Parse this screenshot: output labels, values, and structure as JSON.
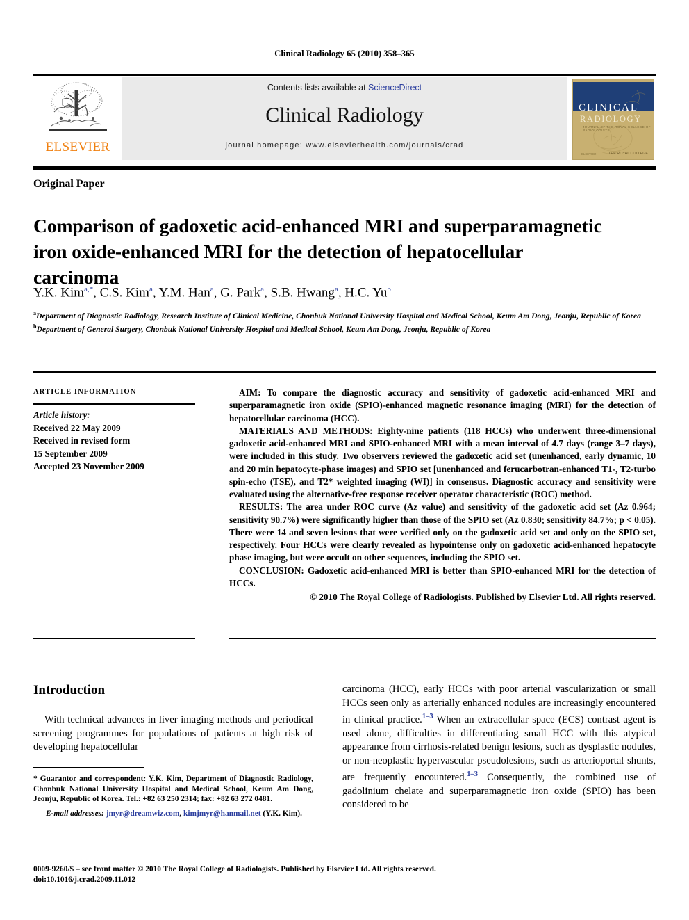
{
  "running_head": "Clinical Radiology 65 (2010) 358–365",
  "banner": {
    "contents_prefix": "Contents lists available at ",
    "sciencedirect": "ScienceDirect",
    "journal_name": "Clinical Radiology",
    "homepage": "journal homepage: www.elsevierhealth.com/journals/crad",
    "publisher_logo_word": "ELSEVIER",
    "cover": {
      "title_line1": "CLINICAL",
      "title_line2": "RADIOLOGY",
      "subtitle": "JOURNAL OF THE ROYAL COLLEGE OF RADIOLOGISTS",
      "footer_left": "ELSEVIER",
      "footer_right": "THE ROYAL COLLEGE"
    }
  },
  "article": {
    "type": "Original Paper",
    "title": "Comparison of gadoxetic acid-enhanced MRI and superparamagnetic iron oxide-enhanced MRI for the detection of hepatocellular carcinoma",
    "authors": [
      {
        "name": "Y.K. Kim",
        "sup": "a,*"
      },
      {
        "name": "C.S. Kim",
        "sup": "a"
      },
      {
        "name": "Y.M. Han",
        "sup": "a"
      },
      {
        "name": "G. Park",
        "sup": "a"
      },
      {
        "name": "S.B. Hwang",
        "sup": "a"
      },
      {
        "name": "H.C. Yu",
        "sup": "b"
      }
    ],
    "affiliations": [
      {
        "marker": "a",
        "text": "Department of Diagnostic Radiology, Research Institute of Clinical Medicine, Chonbuk National University Hospital and Medical School, Keum Am Dong, Jeonju, Republic of Korea"
      },
      {
        "marker": "b",
        "text": "Department of General Surgery, Chonbuk National University Hospital and Medical School, Keum Am Dong, Jeonju, Republic of Korea"
      }
    ]
  },
  "article_information": {
    "heading": "ARTICLE INFORMATION",
    "history_label": "Article history:",
    "history": [
      "Received 22 May 2009",
      "Received in revised form",
      "15 September 2009",
      "Accepted 23 November 2009"
    ]
  },
  "abstract": {
    "aim": "AIM: To compare the diagnostic accuracy and sensitivity of gadoxetic acid-enhanced MRI and superparamagnetic iron oxide (SPIO)-enhanced magnetic resonance imaging (MRI) for the detection of hepatocellular carcinoma (HCC).",
    "materials": "MATERIALS AND METHODS: Eighty-nine patients (118 HCCs) who underwent three-dimensional gadoxetic acid-enhanced MRI and SPIO-enhanced MRI with a mean interval of 4.7 days (range 3–7 days), were included in this study. Two observers reviewed the gadoxetic acid set (unenhanced, early dynamic, 10 and 20 min hepatocyte-phase images) and SPIO set [unenhanced and ferucarbotran-enhanced T1-, T2-turbo spin-echo (TSE), and T2* weighted imaging (WI)] in consensus. Diagnostic accuracy and sensitivity were evaluated using the alternative-free response receiver operator characteristic (ROC) method.",
    "results": "RESULTS: The area under ROC curve (Az value) and sensitivity of the gadoxetic acid set (Az 0.964; sensitivity 90.7%) were significantly higher than those of the SPIO set (Az 0.830; sensitivity 84.7%; p < 0.05). There were 14 and seven lesions that were verified only on the gadoxetic acid set and only on the SPIO set, respectively. Four HCCs were clearly revealed as hypointense only on gadoxetic acid-enhanced hepatocyte phase imaging, but were occult on other sequences, including the SPIO set.",
    "conclusion": "CONCLUSION: Gadoxetic acid-enhanced MRI is better than SPIO-enhanced MRI for the detection of HCCs.",
    "copyright": "© 2010 The Royal College of Radiologists. Published by Elsevier Ltd. All rights reserved."
  },
  "introduction": {
    "heading": "Introduction",
    "left_column": "With technical advances in liver imaging methods and periodical screening programmes for populations of patients at high risk of developing hepatocellular",
    "right_part1": "carcinoma (HCC), early HCCs with poor arterial vascularization or small HCCs seen only as arterially enhanced nodules are increasingly encountered in clinical practice.",
    "right_ref1": "1–3",
    "right_part2": " When an extracellular space (ECS) contrast agent is used alone, difficulties in differentiating small HCC with this atypical appearance from cirrhosis-related benign lesions, such as dysplastic nodules, or non-neoplastic hypervascular pseudolesions, such as arterioportal shunts, are frequently encountered.",
    "right_ref2": "1–3",
    "right_part3": " Consequently, the combined use of gadolinium chelate and superparamagnetic iron oxide (SPIO) has been considered to be"
  },
  "footnote": {
    "corresponding": "* Guarantor and correspondent: Y.K. Kim, Department of Diagnostic Radiology, Chonbuk National University Hospital and Medical School, Keum Am Dong, Jeonju, Republic of Korea. Tel.: +82 63 250 2314; fax: +82 63 272 0481.",
    "email_label": "E-mail addresses:",
    "email1": "jmyr@dreamwiz.com",
    "email_sep": ", ",
    "email2": "kimjmyr@hanmail.net",
    "email_suffix": " (Y.K. Kim)."
  },
  "imprint": {
    "line1": "0009-9260/$ – see front matter © 2010 The Royal College of Radiologists. Published by Elsevier Ltd. All rights reserved.",
    "line2": "doi:10.1016/j.crad.2009.11.012"
  },
  "colors": {
    "link_blue": "#2a3d9e",
    "elsevier_orange": "#f08010",
    "banner_gray": "#eaeaea",
    "cover_blue": "#1f3f77",
    "cover_tan": "#c8b071"
  }
}
